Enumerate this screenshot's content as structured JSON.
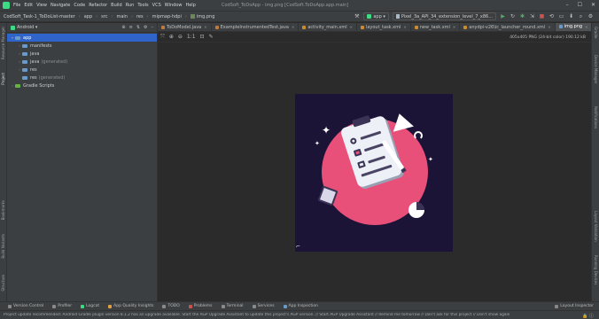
{
  "titlebar": {
    "menu": [
      "File",
      "Edit",
      "View",
      "Navigate",
      "Code",
      "Refactor",
      "Build",
      "Run",
      "Tools",
      "VCS",
      "Window",
      "Help"
    ],
    "window_title": "CodSoft_ToDoApp - img.png [CodSoft.ToDoApp.app.main]",
    "minimize": "–",
    "maximize": "☐",
    "close": "✕"
  },
  "navbar": {
    "breadcrumbs": [
      "CodSoft_Task-1_ToDoList-master",
      "app",
      "src",
      "main",
      "res",
      "mipmap-hdpi",
      "img.png"
    ],
    "separator": "›",
    "run_config": "app",
    "device": "Pixel_3a_API_34_extension_level_7_x86..."
  },
  "project_panel": {
    "view_selector": "Android ▾",
    "tools": [
      "⊕",
      "≡",
      "⇅",
      "⚙",
      "–"
    ],
    "tree": [
      {
        "label": "app",
        "indent": 0,
        "chevron": "▾",
        "folder": "blue",
        "selected": true,
        "suffix": ""
      },
      {
        "label": "manifests",
        "indent": 1,
        "chevron": "›",
        "folder": "blue",
        "selected": false,
        "suffix": ""
      },
      {
        "label": "java",
        "indent": 1,
        "chevron": "›",
        "folder": "blue",
        "selected": false,
        "suffix": ""
      },
      {
        "label": "java",
        "indent": 1,
        "chevron": "›",
        "folder": "blue",
        "selected": false,
        "suffix": "(generated)"
      },
      {
        "label": "res",
        "indent": 1,
        "chevron": "›",
        "folder": "blue",
        "selected": false,
        "suffix": ""
      },
      {
        "label": "res",
        "indent": 1,
        "chevron": "",
        "folder": "blue",
        "selected": false,
        "suffix": "(generated)"
      },
      {
        "label": "Gradle Scripts",
        "indent": 0,
        "chevron": "›",
        "folder": "green",
        "selected": false,
        "suffix": ""
      }
    ]
  },
  "tabs": [
    {
      "label": "ToDoModel.java",
      "color": "#c07a3a",
      "active": false
    },
    {
      "label": "ExampleInstrumentedTest.java",
      "color": "#c07a3a",
      "active": false
    },
    {
      "label": "activity_main.xml",
      "color": "#d08a2e",
      "active": false
    },
    {
      "label": "layout_task.xml",
      "color": "#d08a2e",
      "active": false
    },
    {
      "label": "new_task.xml",
      "color": "#d08a2e",
      "active": false
    },
    {
      "label": "anydpi-v26\\ic_launcher_round.xml",
      "color": "#d08a2e",
      "active": false
    },
    {
      "label": "img.png",
      "color": "#6a9ac9",
      "active": true
    }
  ],
  "image_toolbar": [
    "⤧",
    "⊕",
    "⊖",
    "1:1",
    "⊡",
    "✎"
  ],
  "image_info": "405x405 PNG (24-bit color) 190.12 kB",
  "left_strip": [
    "Resource Manager",
    "Project",
    "Bookmarks",
    "Build Variants",
    "Structure"
  ],
  "right_strip": [
    "Gradle",
    "Device Manager",
    "Notifications",
    "Layout Validation",
    "Running Devices"
  ],
  "bottom_tools": [
    {
      "label": "Version Control",
      "color": "#8a8a8a"
    },
    {
      "label": "Profiler",
      "color": "#8a8a8a"
    },
    {
      "label": "Logcat",
      "color": "#3ddc84"
    },
    {
      "label": "App Quality Insights",
      "color": "#e0a040"
    },
    {
      "label": "TODO",
      "color": "#8a8a8a"
    },
    {
      "label": "Problems",
      "color": "#c75450"
    },
    {
      "label": "Terminal",
      "color": "#8a8a8a"
    },
    {
      "label": "Services",
      "color": "#8a8a8a"
    },
    {
      "label": "App Inspection",
      "color": "#6a9ac9"
    }
  ],
  "bottom_right": "Layout Inspector",
  "status": {
    "message": "Project update recommended: Android Gradle plugin version 8.1.2 has an upgrade available. Start the AGP Upgrade Assistant to update this project's AGP version. // Start AGP Upgrade Assistant // Remind me tomorrow // Don't ask for this project // Don't show again",
    "right": "🔒 ⓘ"
  },
  "colors": {
    "accent": "#2f65ca",
    "canvas_bg": "#1c1437",
    "circle": "#e8507a"
  }
}
